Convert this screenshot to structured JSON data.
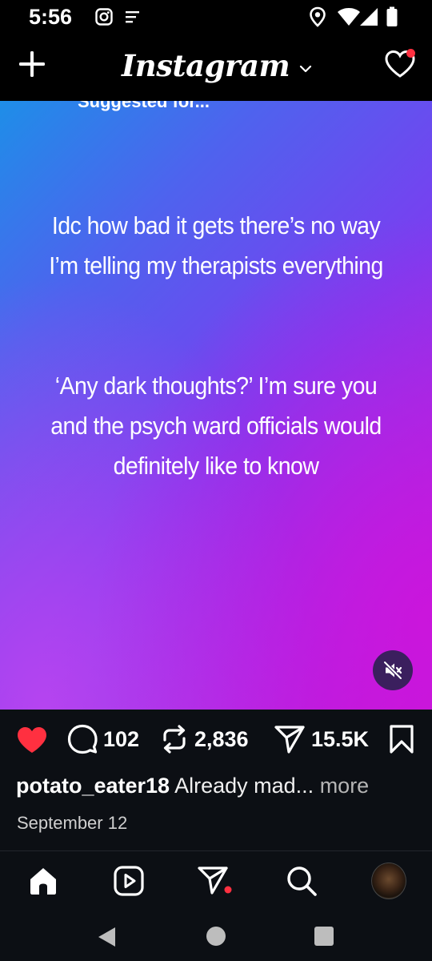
{
  "status_bar": {
    "time": "5:56",
    "icons": [
      "instagram-status-icon",
      "notes-icon",
      "location-icon",
      "wifi-icon",
      "signal-icon",
      "battery-icon"
    ]
  },
  "header": {
    "logo_text": "Instagram",
    "icons": [
      "plus-icon",
      "chevron-down-icon",
      "heart-icon"
    ],
    "notification_dot_color": "#ff3040"
  },
  "post": {
    "suggested_label": "Suggested for...",
    "text_block_1": "Idc how bad it gets there’s no way I’m telling my therapists everything",
    "text_block_2": "‘Any dark thoughts?’ I’m sure you and the psych ward officials would definitely like to know",
    "gradient_colors": [
      "#1e8ee8",
      "#7a3ef0",
      "#c11ad8"
    ],
    "mute_icon": "muted-speaker-icon"
  },
  "actions": {
    "liked": true,
    "like_color": "#ff3040",
    "comments": "102",
    "reposts": "2,836",
    "shares": "15.5K",
    "icons": [
      "heart-filled-icon",
      "comment-icon",
      "repost-icon",
      "share-icon",
      "bookmark-icon"
    ]
  },
  "caption": {
    "username": "potato_eater18",
    "text": "Already mad...",
    "more": "more",
    "date": "September 12"
  },
  "bottom_nav": {
    "items": [
      "home-icon",
      "reels-icon",
      "direct-icon",
      "search-icon",
      "profile-avatar"
    ],
    "direct_badge_color": "#ff3040"
  },
  "system_nav": [
    "back-icon",
    "home-circle-icon",
    "recents-icon"
  ]
}
